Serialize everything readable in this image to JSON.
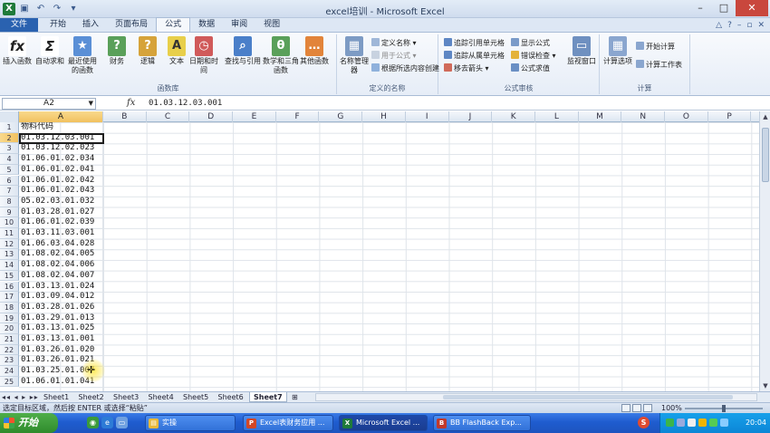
{
  "window": {
    "title": "excel培训 - Microsoft Excel",
    "controls": [
      "–",
      "□",
      "✕"
    ]
  },
  "ribbon_tabs": [
    {
      "label": "文件",
      "kind": "file"
    },
    {
      "label": "开始",
      "kind": ""
    },
    {
      "label": "插入",
      "kind": ""
    },
    {
      "label": "页面布局",
      "kind": ""
    },
    {
      "label": "公式",
      "kind": "active"
    },
    {
      "label": "数据",
      "kind": ""
    },
    {
      "label": "审阅",
      "kind": ""
    },
    {
      "label": "视图",
      "kind": ""
    }
  ],
  "ribbon": {
    "function_library": {
      "label": "函数库",
      "buttons": [
        {
          "name": "insert-function-button",
          "icon": "fx-icon",
          "glyph": "fx",
          "color": "#ffffff",
          "text_color": "#222222",
          "label": "插入函数"
        },
        {
          "name": "autosum-button",
          "icon": "sigma-icon",
          "glyph": "Σ",
          "color": "#ffffff",
          "text_color": "#222222",
          "label": "自动求和"
        },
        {
          "name": "recently-used-button",
          "icon": "book-icon",
          "glyph": "★",
          "color": "#5a8fd6",
          "text_color": "#ffffff",
          "label": "最近使用的函数"
        },
        {
          "name": "financial-button",
          "icon": "book-icon",
          "glyph": "?",
          "color": "#5aa05a",
          "text_color": "#ffffff",
          "label": "财务"
        },
        {
          "name": "logical-button",
          "icon": "book-icon",
          "glyph": "?",
          "color": "#d6a33a",
          "text_color": "#ffffff",
          "label": "逻辑"
        },
        {
          "name": "text-button",
          "icon": "book-icon",
          "glyph": "A",
          "color": "#e8cf4a",
          "text_color": "#333333",
          "label": "文本"
        },
        {
          "name": "date-time-button",
          "icon": "book-icon",
          "glyph": "◷",
          "color": "#d05a5a",
          "text_color": "#ffffff",
          "label": "日期和时间"
        },
        {
          "name": "lookup-button",
          "icon": "book-icon",
          "glyph": "⌕",
          "color": "#4a7fc9",
          "text_color": "#ffffff",
          "label": "查找与引用"
        },
        {
          "name": "math-trig-button",
          "icon": "book-icon",
          "glyph": "θ",
          "color": "#5aa05a",
          "text_color": "#ffffff",
          "label": "数学和三角函数"
        },
        {
          "name": "more-functions-button",
          "icon": "book-icon",
          "glyph": "…",
          "color": "#e2843a",
          "text_color": "#ffffff",
          "label": "其他函数"
        }
      ]
    },
    "defined_names": {
      "label": "定义的名称",
      "name_manager": "名称管理器",
      "items": [
        "定义名称 ▾",
        "用于公式 ▾",
        "根据所选内容创建"
      ]
    },
    "formula_auditing": {
      "label": "公式审核",
      "items_left": [
        "追踪引用单元格",
        "追踪从属单元格",
        "移去箭头 ▾"
      ],
      "items_right": [
        "显示公式",
        "错误检查 ▾",
        "公式求值"
      ],
      "watch_window": "监视窗口"
    },
    "calculation": {
      "label": "计算",
      "options": "计算选项",
      "items": [
        "开始计算",
        "计算工作表"
      ]
    }
  },
  "formula_bar": {
    "name_box": "A2",
    "fx": "fx",
    "content": "01.03.12.03.001"
  },
  "columns": [
    "A",
    "B",
    "C",
    "D",
    "E",
    "F",
    "G",
    "H",
    "I",
    "J",
    "K",
    "L",
    "M",
    "N",
    "O",
    "P"
  ],
  "rows": [
    {
      "n": "1",
      "a": "物料代码"
    },
    {
      "n": "2",
      "a": "01.03.12.03.001"
    },
    {
      "n": "3",
      "a": "01.03.12.02.023"
    },
    {
      "n": "4",
      "a": "01.06.01.02.034"
    },
    {
      "n": "5",
      "a": "01.06.01.02.041"
    },
    {
      "n": "6",
      "a": "01.06.01.02.042"
    },
    {
      "n": "7",
      "a": "01.06.01.02.043"
    },
    {
      "n": "8",
      "a": "05.02.03.01.032"
    },
    {
      "n": "9",
      "a": "01.03.28.01.027"
    },
    {
      "n": "10",
      "a": "01.06.01.02.039"
    },
    {
      "n": "11",
      "a": "01.03.11.03.001"
    },
    {
      "n": "12",
      "a": "01.06.03.04.028"
    },
    {
      "n": "13",
      "a": "01.08.02.04.005"
    },
    {
      "n": "14",
      "a": "01.08.02.04.006"
    },
    {
      "n": "15",
      "a": "01.08.02.04.007"
    },
    {
      "n": "16",
      "a": "01.03.13.01.024"
    },
    {
      "n": "17",
      "a": "01.03.09.04.012"
    },
    {
      "n": "18",
      "a": "01.03.28.01.026"
    },
    {
      "n": "19",
      "a": "01.03.29.01.013"
    },
    {
      "n": "20",
      "a": "01.03.13.01.025"
    },
    {
      "n": "21",
      "a": "01.03.13.01.001"
    },
    {
      "n": "22",
      "a": "01.03.26.01.020"
    },
    {
      "n": "23",
      "a": "01.03.26.01.021"
    },
    {
      "n": "24",
      "a": "01.03.25.01.007"
    },
    {
      "n": "25",
      "a": "01.06.01.01.041"
    }
  ],
  "sheets": [
    "Sheet1",
    "Sheet2",
    "Sheet3",
    "Sheet4",
    "Sheet5",
    "Sheet6",
    "Sheet7"
  ],
  "active_sheet": "Sheet7",
  "status": {
    "message": "选定目标区域，然后按 ENTER 或选择“粘贴”",
    "zoom": "100%"
  },
  "taskbar": {
    "start": "开始",
    "items": [
      {
        "label": "实操",
        "icon_color": "#e8b93a",
        "glyph": "▤"
      },
      {
        "label": "Excel表财务应用 ...",
        "icon_color": "#d24726",
        "glyph": "P"
      },
      {
        "label": "Microsoft Excel ...",
        "icon_color": "#1f7a3a",
        "glyph": "X"
      },
      {
        "label": "BB FlashBack Exp...",
        "icon_color": "#c0392b",
        "glyph": "B"
      }
    ],
    "clock": "20:04"
  }
}
